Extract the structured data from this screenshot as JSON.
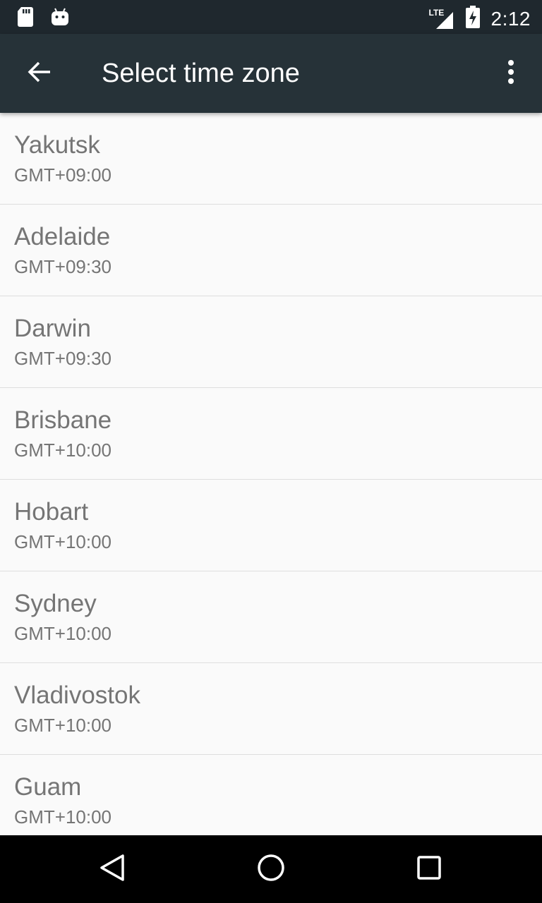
{
  "status_bar": {
    "time": "2:12",
    "network_label": "LTE",
    "icons": [
      "sd-card-icon",
      "android-icon",
      "signal-icon",
      "battery-charging-icon"
    ]
  },
  "app_bar": {
    "title": "Select time zone",
    "back_icon": "arrow-back-icon",
    "overflow_icon": "more-vert-icon"
  },
  "time_zones": [
    {
      "name": "Yakutsk",
      "offset": "GMT+09:00"
    },
    {
      "name": "Adelaide",
      "offset": "GMT+09:30"
    },
    {
      "name": "Darwin",
      "offset": "GMT+09:30"
    },
    {
      "name": "Brisbane",
      "offset": "GMT+10:00"
    },
    {
      "name": "Hobart",
      "offset": "GMT+10:00"
    },
    {
      "name": "Sydney",
      "offset": "GMT+10:00"
    },
    {
      "name": "Vladivostok",
      "offset": "GMT+10:00"
    },
    {
      "name": "Guam",
      "offset": "GMT+10:00"
    }
  ],
  "nav_bar": {
    "icons": [
      "back-triangle-icon",
      "home-circle-icon",
      "recents-square-icon"
    ]
  },
  "colors": {
    "status_bar": "#1f282e",
    "app_bar": "#263238",
    "list_background": "#fafafa",
    "list_text": "#757575",
    "divider": "#dedede",
    "nav_bar": "#000000"
  }
}
